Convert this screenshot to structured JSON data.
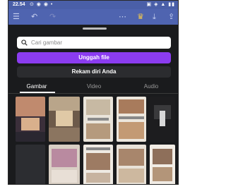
{
  "status_bar": {
    "time": "22.54",
    "left_icons": "⊙ ◉ ◉ •",
    "right_icons": "▣ ◈ ▲ ▮▮"
  },
  "toolbar": {
    "icons": [
      "menu-icon",
      "undo-icon",
      "redo-icon",
      "more-icon",
      "crown-icon",
      "download-icon",
      "share-icon"
    ],
    "crown_color": "#f2c84b"
  },
  "search": {
    "placeholder": "Cari gambar"
  },
  "upload_button": {
    "label": "Unggah file",
    "color": "#8b3cf0"
  },
  "record_button": {
    "label": "Rekam diri Anda"
  },
  "tabs": [
    {
      "label": "Gambar",
      "active": true
    },
    {
      "label": "Video",
      "active": false
    },
    {
      "label": "Audio",
      "active": false
    }
  ],
  "grid": {
    "thumbnail_count": 10
  }
}
